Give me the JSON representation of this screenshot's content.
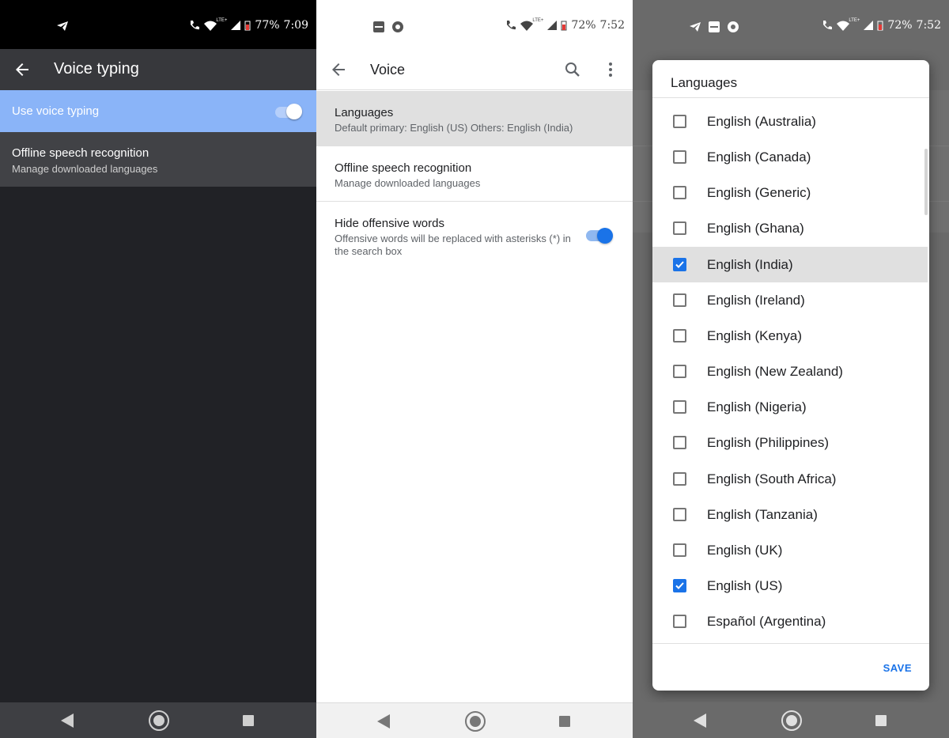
{
  "panel1": {
    "status": {
      "battery": "77%",
      "time": "7:09"
    },
    "appbar": {
      "title": "Voice typing"
    },
    "use_voice_typing": {
      "label": "Use voice typing",
      "enabled": true
    },
    "offline": {
      "title": "Offline speech recognition",
      "subtitle": "Manage downloaded languages"
    }
  },
  "panel2": {
    "status": {
      "battery": "72%",
      "time": "7:52"
    },
    "appbar": {
      "title": "Voice"
    },
    "languages": {
      "title": "Languages",
      "subtitle": "Default primary: English (US) Others: English (India)"
    },
    "offline": {
      "title": "Offline speech recognition",
      "subtitle": "Manage downloaded languages"
    },
    "hide_offensive": {
      "title": "Hide offensive words",
      "subtitle": "Offensive words will be replaced with asterisks (*) in the search box",
      "enabled": true
    }
  },
  "panel3": {
    "status": {
      "battery": "72%",
      "time": "7:52"
    },
    "dialog": {
      "title": "Languages",
      "save_label": "SAVE",
      "items": [
        {
          "label": "English (Australia)",
          "checked": false
        },
        {
          "label": "English (Canada)",
          "checked": false
        },
        {
          "label": "English (Generic)",
          "checked": false
        },
        {
          "label": "English (Ghana)",
          "checked": false
        },
        {
          "label": "English (India)",
          "checked": true
        },
        {
          "label": "English (Ireland)",
          "checked": false
        },
        {
          "label": "English (Kenya)",
          "checked": false
        },
        {
          "label": "English (New Zealand)",
          "checked": false
        },
        {
          "label": "English (Nigeria)",
          "checked": false
        },
        {
          "label": "English (Philippines)",
          "checked": false
        },
        {
          "label": "English (South Africa)",
          "checked": false
        },
        {
          "label": "English (Tanzania)",
          "checked": false
        },
        {
          "label": "English (UK)",
          "checked": false
        },
        {
          "label": "English (US)",
          "checked": true
        },
        {
          "label": "Español (Argentina)",
          "checked": false
        }
      ]
    }
  },
  "colors": {
    "accent": "#1a73e8",
    "voice_row_highlight": "#8ab4f8",
    "dark_bg": "#212226"
  }
}
